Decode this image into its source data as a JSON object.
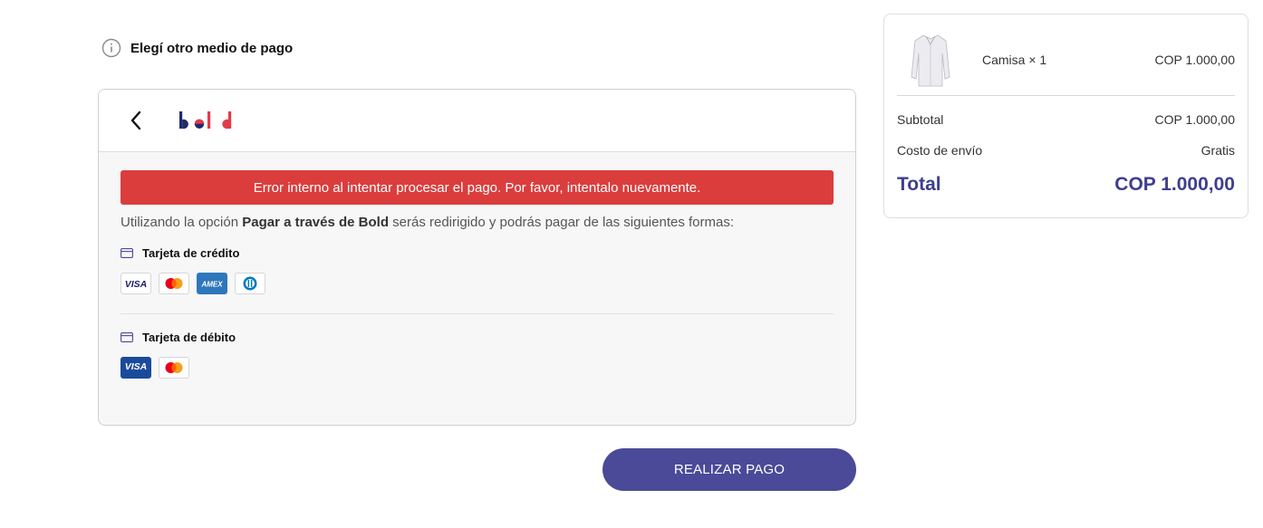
{
  "payment": {
    "choose_other_label": "Elegí otro medio de pago",
    "provider_logo": "bold",
    "error_message": "Error interno al intentar procesar el pago. Por favor, intentalo nuevamente.",
    "redirect_prefix": "Utilizando la opción ",
    "redirect_bold": "Pagar a través de Bold",
    "redirect_suffix": " serás redirigido y podrás pagar de las siguientes formas:",
    "methods": [
      {
        "title": "Tarjeta de crédito",
        "icon": "card-icon",
        "brands": [
          "VISA",
          "Mastercard",
          "AMEX",
          "Diners Club"
        ]
      },
      {
        "title": "Tarjeta de débito",
        "icon": "card-icon",
        "brands": [
          "VISA",
          "Mastercard"
        ]
      }
    ],
    "submit_label": "REALIZAR PAGO"
  },
  "summary": {
    "product": {
      "name": "Camisa",
      "quantity_label": "× 1",
      "price": "COP 1.000,00"
    },
    "subtotal_label": "Subtotal",
    "subtotal_value": "COP 1.000,00",
    "shipping_label": "Costo de envío",
    "shipping_value": "Gratis",
    "total_label": "Total",
    "total_value": "COP 1.000,00"
  },
  "colors": {
    "accent": "#4a4a98",
    "error": "#db3d3d",
    "total": "#3e3e8e",
    "bold_navy": "#1e2a6b",
    "bold_red": "#e23a4a"
  }
}
